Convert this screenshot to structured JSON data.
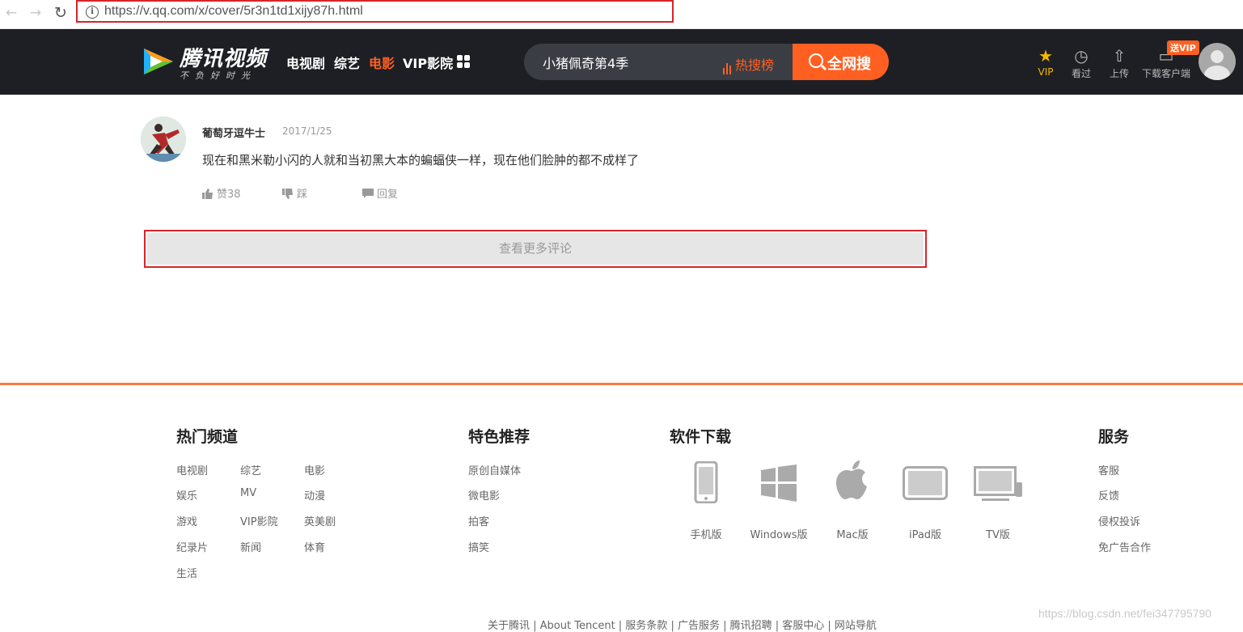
{
  "browser": {
    "url": "https://v.qq.com/x/cover/5r3n1td1xijy87h.html"
  },
  "header": {
    "logo_title": "腾讯视频",
    "logo_slogan": "不负好时光",
    "nav": [
      "电视剧",
      "综艺",
      "电影",
      "VIP影院"
    ],
    "search_value": "小猪佩奇第4季",
    "hot_rank": "热搜榜",
    "search_button": "全网搜",
    "icons": {
      "vip": "VIP",
      "history": "看过",
      "upload": "上传",
      "download": "下载客户端",
      "vip_badge": "送VIP"
    },
    "accent": "#ff6022"
  },
  "comment": {
    "user": "葡萄牙逗牛士",
    "date": "2017/1/25",
    "text": "现在和黑米勒小闪的人就和当初黑大本的蝙蝠侠一样，现在他们脸肿的都不成样了",
    "like": "赞38",
    "dislike": "踩",
    "reply": "回复"
  },
  "more_comments": "查看更多评论",
  "footer": {
    "hot_channels": {
      "title": "热门频道",
      "items": [
        "电视剧",
        "综艺",
        "电影",
        "娱乐",
        "MV",
        "动漫",
        "游戏",
        "VIP影院",
        "英美剧",
        "纪录片",
        "新闻",
        "体育",
        "生活"
      ]
    },
    "featured": {
      "title": "特色推荐",
      "items": [
        "原创自媒体",
        "微电影",
        "拍客",
        "搞笑"
      ]
    },
    "software": {
      "title": "软件下载",
      "items": [
        "手机版",
        "Windows版",
        "Mac版",
        "iPad版",
        "TV版"
      ]
    },
    "service": {
      "title": "服务",
      "items": [
        "客服",
        "反馈",
        "侵权投诉",
        "免广告合作"
      ]
    },
    "bottom_links": "关于腾讯 | About Tencent | 服务条款 | 广告服务 | 腾讯招聘 | 客服中心 | 网站导航"
  },
  "watermark": "https://blog.csdn.net/fei347795790"
}
